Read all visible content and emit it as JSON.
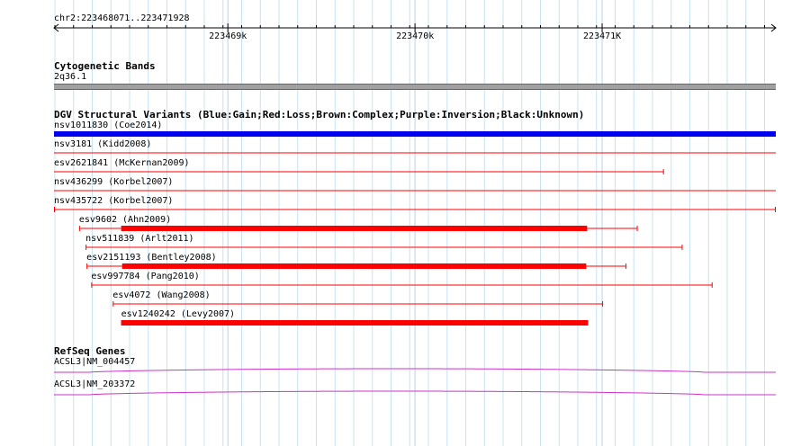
{
  "ruler": {
    "region": "chr2:223468071..223471928",
    "ticks": [
      {
        "label": "223469k",
        "pos": 223469000
      },
      {
        "label": "223470k",
        "pos": 223470000
      },
      {
        "label": "223471K",
        "pos": 223471000
      }
    ]
  },
  "view": {
    "start": 223468071,
    "end": 223471928
  },
  "cytobands": {
    "title": "Cytogenetic Bands",
    "band_label": "2q36.1",
    "band_color": "#a0a0a0"
  },
  "dgv": {
    "title": "DGV Structural Variants (Blue:Gain;Red:Loss;Brown:Complex;Purple:Inversion;Black:Unknown)",
    "gain_color": "#0000ee",
    "loss_color": "#ff0000",
    "variants": [
      {
        "label": "nsv1011830 (Coe2014)",
        "type": "gain",
        "start": 223468071,
        "end": 223471928,
        "thick_start": 223468071,
        "thick_end": 223471928,
        "clipped_left": true,
        "clipped_right": true
      },
      {
        "label": "nsv3181 (Kidd2008)",
        "type": "loss",
        "start": 223468071,
        "end": 223471928,
        "clipped_left": true,
        "clipped_right": true
      },
      {
        "label": "esv2621841 (McKernan2009)",
        "type": "loss",
        "start": 223468071,
        "end": 223471330,
        "clipped_left": true
      },
      {
        "label": "nsv436299 (Korbel2007)",
        "type": "loss",
        "start": 223468071,
        "end": 223471928,
        "clipped_left": true,
        "clipped_right": true
      },
      {
        "label": "nsv435722 (Korbel2007)",
        "type": "loss",
        "start": 223468071,
        "end": 223471928
      },
      {
        "label": "esv9602 (Ahn2009)",
        "type": "loss",
        "start": 223468205,
        "end": 223471190,
        "thick_start": 223468430,
        "thick_end": 223470920
      },
      {
        "label": "nsv511839 (Arlt2011)",
        "type": "loss",
        "start": 223468240,
        "end": 223471430
      },
      {
        "label": "esv2151193 (Bentley2008)",
        "type": "loss",
        "start": 223468245,
        "end": 223471130,
        "thick_start": 223468435,
        "thick_end": 223470915
      },
      {
        "label": "esv997784 (Pang2010)",
        "type": "loss",
        "start": 223468270,
        "end": 223471590
      },
      {
        "label": "esv4072 (Wang2008)",
        "type": "loss",
        "start": 223468385,
        "end": 223471005
      },
      {
        "label": "esv1240242 (Levy2007)",
        "type": "loss",
        "start": 223468430,
        "end": 223470925,
        "thick_start": 223468430,
        "thick_end": 223470925
      }
    ]
  },
  "refseq": {
    "title": "RefSeq Genes",
    "color": "#cc33cc",
    "genes": [
      {
        "label": "ACSL3|NM_004457"
      },
      {
        "label": "ACSL3|NM_203372"
      }
    ]
  }
}
